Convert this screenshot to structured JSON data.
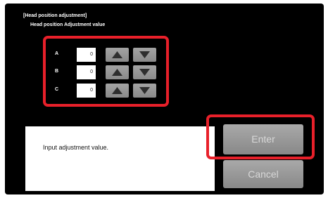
{
  "header": {
    "title": "[Head position adjustment]",
    "subtitle": "Head position Adjustment value"
  },
  "adjustment": {
    "rows": [
      {
        "label": "A",
        "value": "0"
      },
      {
        "label": "B",
        "value": "0"
      },
      {
        "label": "C",
        "value": "0"
      }
    ],
    "up_icon": "triangle-up-icon",
    "down_icon": "triangle-down-icon"
  },
  "message": {
    "text": "Input adjustment value."
  },
  "buttons": {
    "enter_label": "Enter",
    "cancel_label": "Cancel"
  },
  "colors": {
    "background": "#000000",
    "highlight": "#e8202a",
    "button": "#999999",
    "button_text": "#d8d8d8",
    "message_bg": "#ffffff"
  }
}
